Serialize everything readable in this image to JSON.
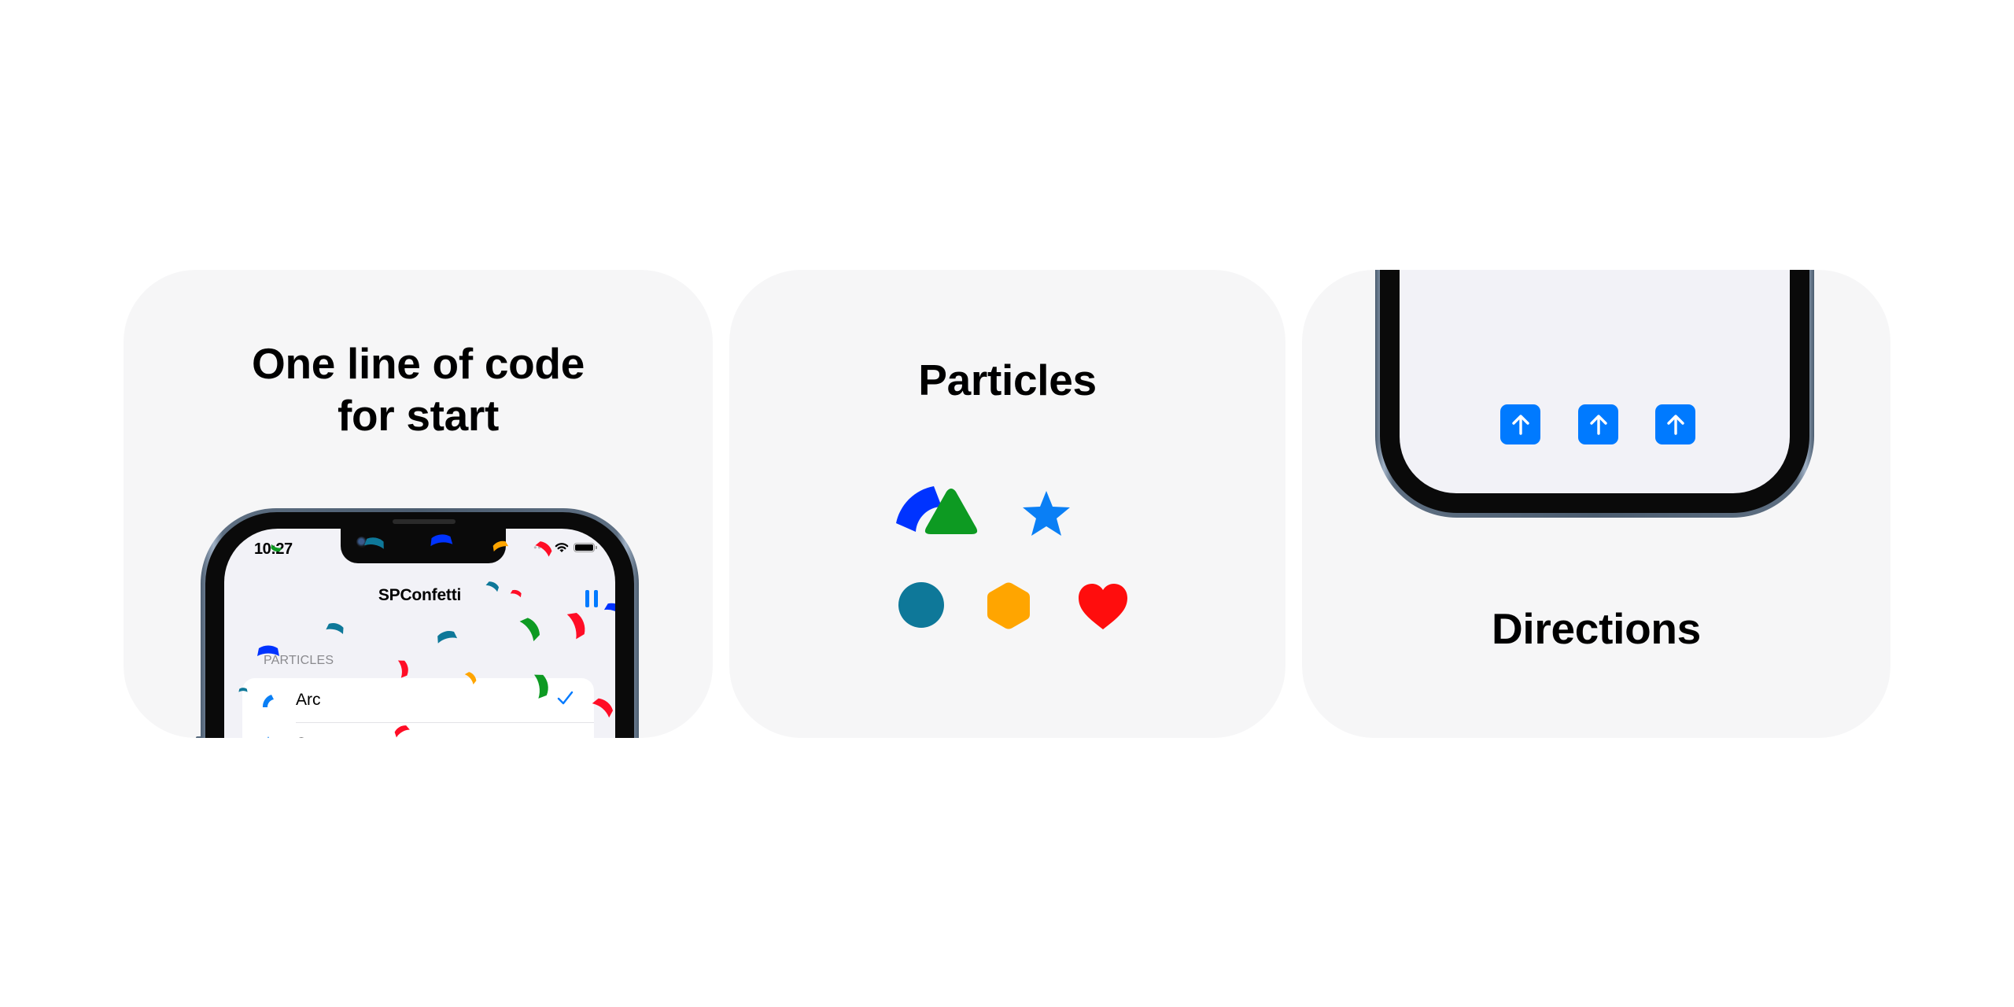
{
  "cards": [
    {
      "id": "card1",
      "title_lines": [
        "One line of code",
        "for start"
      ],
      "phone": {
        "status_time": "10:27",
        "status_icons": [
          "cellular-signal-icon",
          "wifi-icon",
          "battery-icon"
        ],
        "nav_title": "SPConfetti",
        "nav_right_button": "pause-icon",
        "section_header": "PARTICLES",
        "list_rows": [
          {
            "label": "Arc",
            "icon": "arc-confetti-icon",
            "selected": true
          },
          {
            "label": "S",
            "icon": "star-confetti-icon",
            "selected": false
          }
        ]
      }
    },
    {
      "id": "card2",
      "title": "Particles",
      "particles": [
        {
          "name": "arc",
          "color": "#0033ff"
        },
        {
          "name": "triangle",
          "color": "#0d9a22"
        },
        {
          "name": "star",
          "color": "#0a7ff5"
        },
        {
          "name": "circle",
          "color": "#0e7899"
        },
        {
          "name": "hexagon",
          "color": "#ffa500"
        },
        {
          "name": "heart",
          "color": "#ff0d0d"
        }
      ]
    },
    {
      "id": "card3",
      "title": "Directions",
      "direction_buttons": [
        {
          "direction": "up"
        },
        {
          "direction": "up"
        },
        {
          "direction": "up"
        }
      ]
    }
  ],
  "colors": {
    "accent": "#007aff",
    "card_bg": "#f6f6f7",
    "screen_bg": "#f2f2f7",
    "confetti": [
      "#0033ff",
      "#0d9a22",
      "#ff0d26",
      "#ffa500",
      "#0e7899",
      "#0a7ff5"
    ]
  }
}
